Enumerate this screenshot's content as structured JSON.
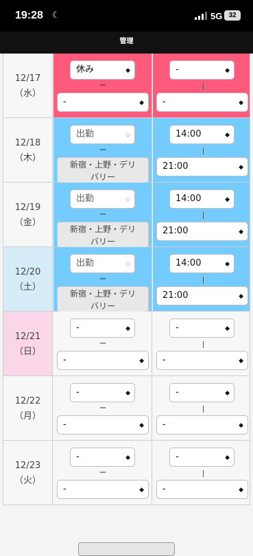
{
  "status_bar": {
    "time": "19:28",
    "network": "5G",
    "battery": "32"
  },
  "header": {
    "title": "管理"
  },
  "rows": [
    {
      "date": "12/17",
      "weekday": "（水）",
      "status": "休み",
      "location": "-",
      "start": "-",
      "end": "-"
    },
    {
      "date": "12/18",
      "weekday": "（木）",
      "status": "出勤",
      "location_line1": "新宿・上野・デリ",
      "location_line2": "バリー",
      "start": "14:00",
      "end": "21:00"
    },
    {
      "date": "12/19",
      "weekday": "（金）",
      "status": "出勤",
      "location_line1": "新宿・上野・デリ",
      "location_line2": "バリー",
      "start": "14:00",
      "end": "21:00"
    },
    {
      "date": "12/20",
      "weekday": "（土）",
      "status": "出勤",
      "location_line1": "新宿・上野・デリ",
      "location_line2": "バリー",
      "start": "14:00",
      "end": "21:00"
    },
    {
      "date": "12/21",
      "weekday": "（日）",
      "status": "-",
      "location": "-",
      "start": "-",
      "end": "-"
    },
    {
      "date": "12/22",
      "weekday": "（月）",
      "status": "-",
      "location": "-",
      "start": "-",
      "end": "-"
    },
    {
      "date": "12/23",
      "weekday": "（火）",
      "status": "-",
      "location": "-",
      "start": "-",
      "end": "-"
    }
  ],
  "separators": {
    "dash": "ー"
  },
  "icons": {
    "select_arrow": "chevron-updown-icon",
    "moon": "moon-icon",
    "signal": "signal-icon"
  },
  "colors": {
    "holiday": "#ff5a7c",
    "working": "#73ccfd",
    "saturday": "#d6ebf8",
    "sunday": "#fbd6e9"
  }
}
